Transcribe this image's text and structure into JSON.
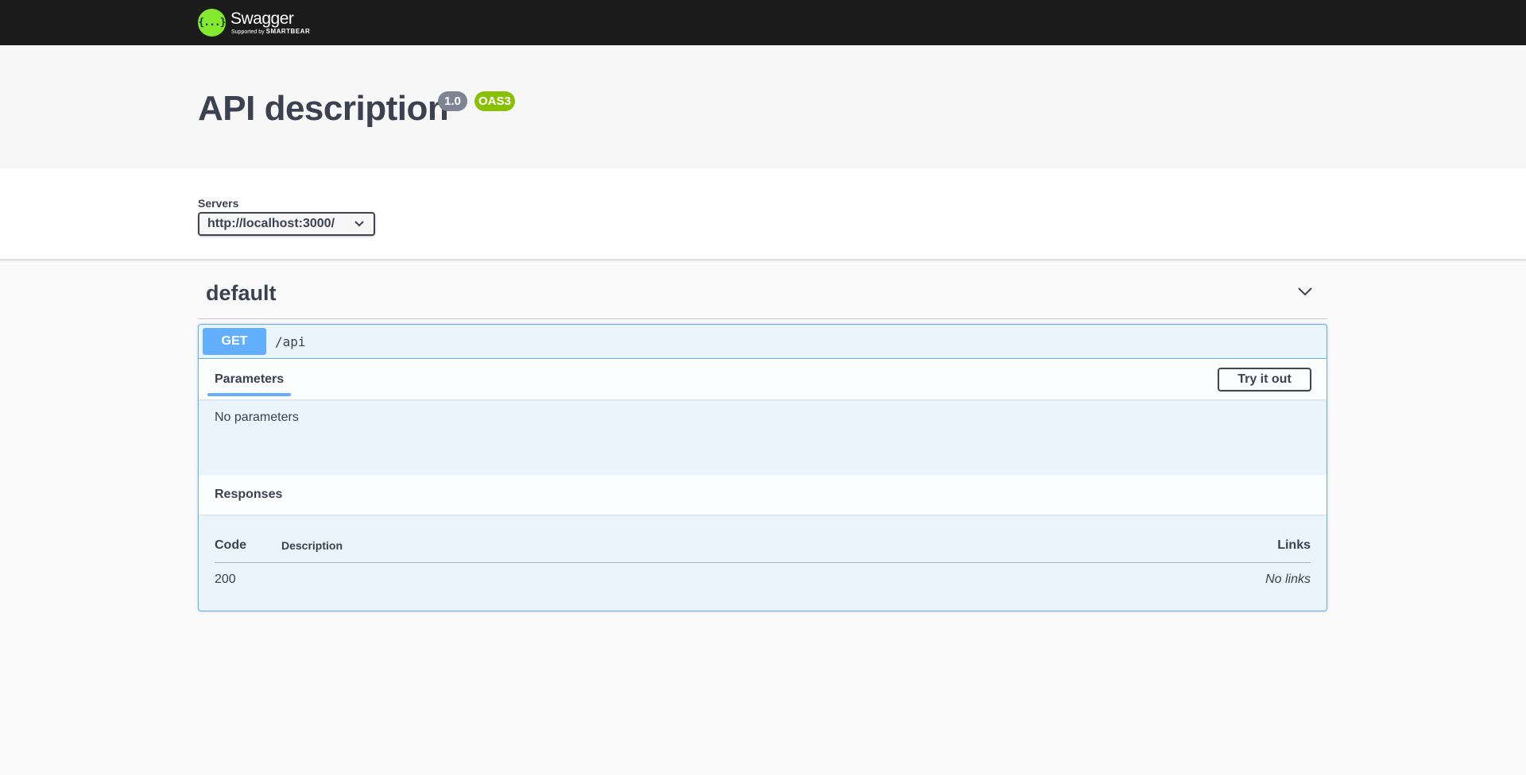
{
  "topbar": {
    "logo_symbol": "{...}",
    "logo_name": "Swagger",
    "logo_supported": "Supported by",
    "logo_brand": "SMARTBEAR"
  },
  "info": {
    "title": "API description",
    "version": "1.0",
    "oas": "OAS3"
  },
  "servers": {
    "label": "Servers",
    "selected": "http://localhost:3000/"
  },
  "tag": {
    "name": "default"
  },
  "operation": {
    "method": "GET",
    "path": "/api",
    "parameters_tab": "Parameters",
    "try_button": "Try it out",
    "no_params": "No parameters",
    "responses_title": "Responses",
    "columns": {
      "code": "Code",
      "description": "Description",
      "links": "Links"
    },
    "responses": [
      {
        "code": "200",
        "description": "",
        "links": "No links"
      }
    ]
  },
  "colors": {
    "topbar": "#1b1b1b",
    "logo": "#85ea2d",
    "get": "#61affe",
    "version_badge": "#7d8492",
    "oas_badge": "#89bf04"
  }
}
